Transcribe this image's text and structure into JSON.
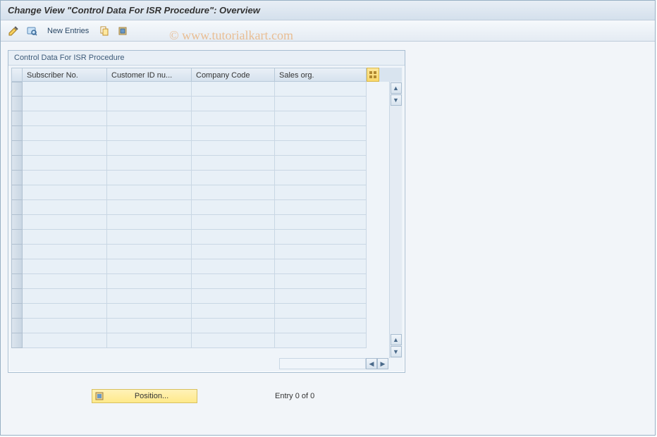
{
  "window": {
    "title": "Change View \"Control Data For ISR Procedure\": Overview"
  },
  "toolbar": {
    "new_entries_label": "New Entries"
  },
  "groupbox": {
    "title": "Control Data For ISR Procedure"
  },
  "table": {
    "columns": {
      "subscriber": "Subscriber No.",
      "customer": "Customer ID nu...",
      "company": "Company Code",
      "sales": "Sales org."
    }
  },
  "footer": {
    "position_label": "Position...",
    "entry_text": "Entry 0 of 0"
  },
  "watermark": "© www.tutorialkart.com"
}
